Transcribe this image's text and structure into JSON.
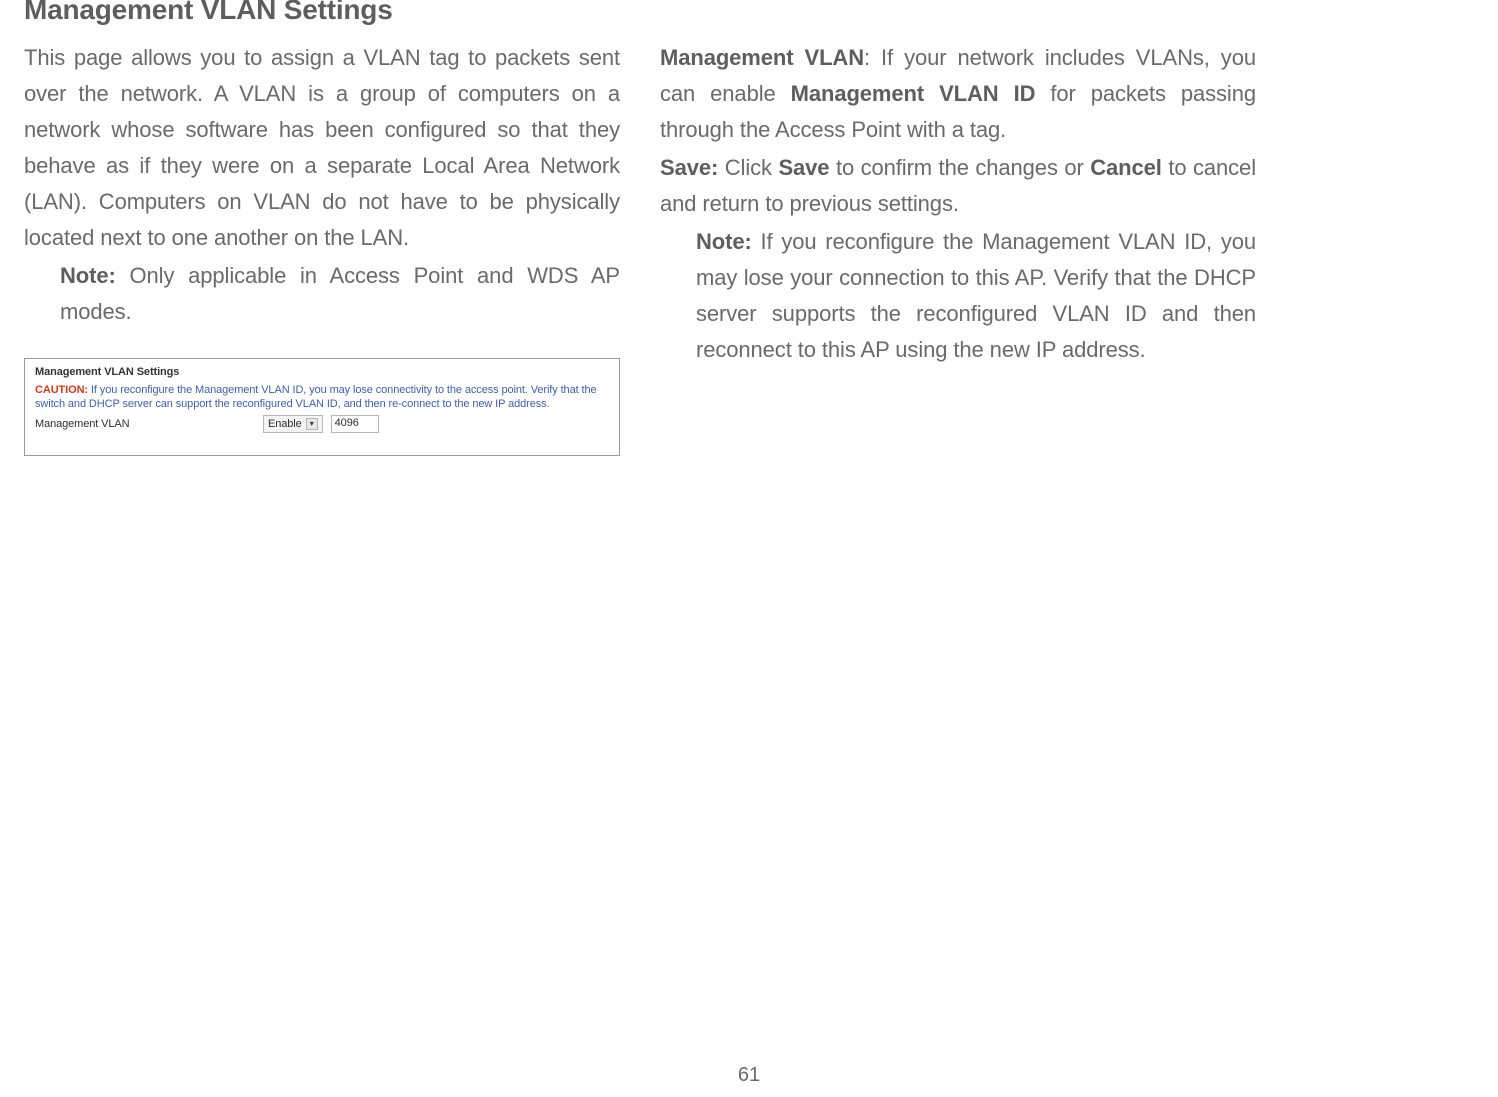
{
  "page": {
    "title": "Management VLAN Settings",
    "number": "61"
  },
  "left": {
    "intro": "This page allows you to assign a VLAN tag to packets sent over the network. A VLAN is a group of computers on a network whose software has been configured so that they behave as if they were on a separate Local Area Network (LAN). Computers on VLAN do not have to be physically located next to one another on the LAN.",
    "note_label": "Note:",
    "note_text": " Only applicable in Access Point and WDS AP modes."
  },
  "shot": {
    "title": "Management VLAN Settings",
    "caution_label": "CAUTION:",
    "caution_text": " If you reconfigure the Management VLAN ID, you may lose connectivity to the access point. Verify that the switch and DHCP server can support the reconfigured VLAN ID, and then re-connect to the new IP address.",
    "row_label": "Management VLAN",
    "dropdown_value": "Enable",
    "input_value": "4096"
  },
  "right": {
    "mv_label": "Management VLAN",
    "mv_text1": ": If your network includes VLANs, you can enable ",
    "mv_bold": "Management VLAN ID",
    "mv_text2": " for packets passing through the Access Point with a tag.",
    "save_label": "Save:",
    "save_text1": " Click ",
    "save_bold1": "Save",
    "save_text2": " to confirm the changes or ",
    "save_bold2": "Cancel",
    "save_text3": " to cancel and return to previous settings.",
    "note_label": "Note:",
    "note_text": " If you reconfigure the Management VLAN ID, you may lose your connection to this AP. Verify that the DHCP server supports the reconfigured VLAN ID and then reconnect to this AP using the new IP address."
  }
}
